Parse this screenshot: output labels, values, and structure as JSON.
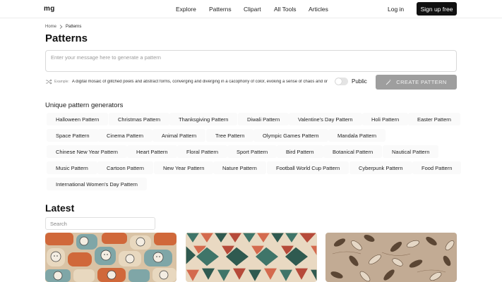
{
  "header": {
    "logo": "mg",
    "nav": [
      {
        "label": "Explore"
      },
      {
        "label": "Patterns"
      },
      {
        "label": "Clipart"
      },
      {
        "label": "All Tools"
      },
      {
        "label": "Articles"
      }
    ],
    "login_label": "Log in",
    "signup_label": "Sign up free"
  },
  "breadcrumb": {
    "home": "Home",
    "current": "Patterns"
  },
  "page_title": "Patterns",
  "prompt": {
    "placeholder": "Enter your message here to generate a pattern",
    "value": ""
  },
  "example": {
    "label": "Example:",
    "text": "A digital mosaic of glitched pixels and abstract forms, converging and diverging in a cacophony of color, evoking a sense of chaos and order"
  },
  "visibility_toggle": {
    "label": "Public",
    "on": false
  },
  "create_button": {
    "label": "CREATE PATTERN",
    "icon": "magic-wand-icon"
  },
  "generators": {
    "title": "Unique pattern generators",
    "chips": [
      "Halloween Pattern",
      "Christmas Pattern",
      "Thanksgiving Pattern",
      "Diwali Pattern",
      "Valentine's Day Pattern",
      "Holi Pattern",
      "Easter Pattern",
      "Space Pattern",
      "Cinema Pattern",
      "Animal Pattern",
      "Tree Pattern",
      "Olympic Games Pattern",
      "Mandala Pattern",
      "Chinese New Year Pattern",
      "Heart Pattern",
      "Floral Pattern",
      "Sport Pattern",
      "Bird Pattern",
      "Botanical Pattern",
      "Nautical Pattern",
      "Music Pattern",
      "Cartoon Pattern",
      "New Year Pattern",
      "Nature Pattern",
      "Football World Cup Pattern",
      "Cyberpunk Pattern",
      "Food Pattern",
      "International Women's Day Pattern"
    ]
  },
  "latest": {
    "title": "Latest",
    "search_placeholder": "Search",
    "cards": [
      {
        "theme": "cartoon-cats",
        "colors": [
          "#d9c3a5",
          "#d0683a",
          "#7fa6a7",
          "#e8d8bf",
          "#3a3a3a"
        ]
      },
      {
        "theme": "geometric-leaves",
        "colors": [
          "#e9d9c2",
          "#3f7569",
          "#d46a4e",
          "#2f5a50",
          "#b64a3a"
        ]
      },
      {
        "theme": "botanical-leaves",
        "colors": [
          "#c2ab94",
          "#5b4634",
          "#e6d8c6",
          "#8a6f57"
        ]
      }
    ]
  }
}
